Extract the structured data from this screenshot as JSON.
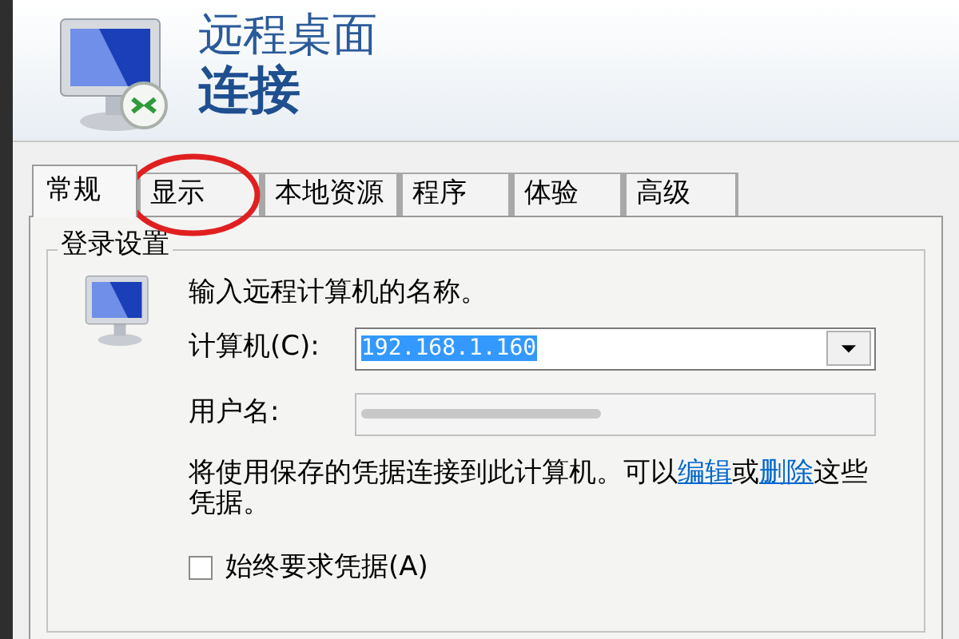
{
  "header": {
    "title_line_1": "远程桌面",
    "title_line_2": "连接"
  },
  "tabs": [
    {
      "label": "常规",
      "selected": true
    },
    {
      "label": "显示",
      "selected": false,
      "circled": true
    },
    {
      "label": "本地资源",
      "selected": false
    },
    {
      "label": "程序",
      "selected": false
    },
    {
      "label": "体验",
      "selected": false
    },
    {
      "label": "高级",
      "selected": false
    }
  ],
  "group": {
    "title": "登录设置",
    "prompt": "输入远程计算机的名称。",
    "computer_label": "计算机(C):",
    "computer_value": "192.168.1.160",
    "username_label": "用户名:",
    "info_parts": [
      "将使用保存的凭据连接到此计算机。可以",
      "编辑",
      "或",
      "删除",
      "这些凭据。"
    ],
    "always_ask": {
      "label": "始终要求凭据(A)",
      "checked": false
    }
  }
}
